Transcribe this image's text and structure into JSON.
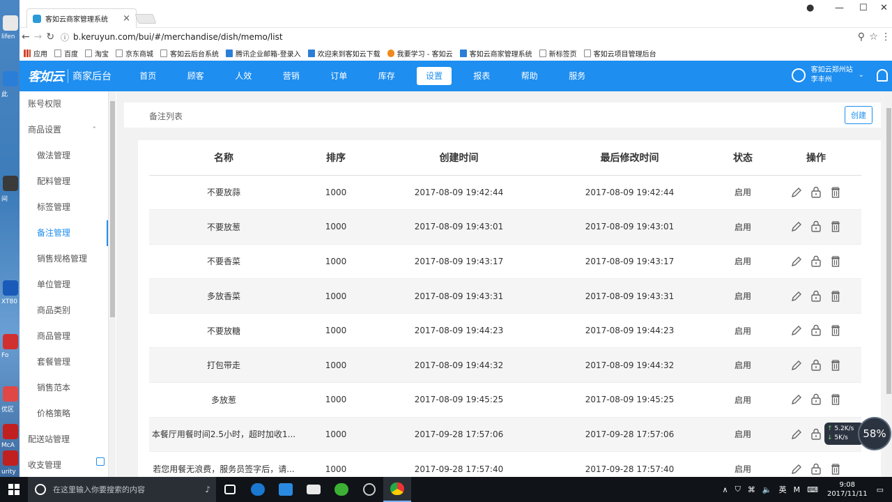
{
  "desktop": {
    "labels": [
      "lifen",
      "此",
      "间",
      "XT80",
      "Fo",
      "优区",
      "McA",
      "urity"
    ]
  },
  "browser": {
    "tab_title": "客如云商家管理系统",
    "url": "b.keruyun.com/bui/#/merchandise/dish/memo/list",
    "bookmarks": [
      "应用",
      "百度",
      "淘宝",
      "京东商城",
      "客如云后台系统",
      "腾讯企业邮箱-登录入",
      "欢迎来到客如云下载",
      "我要学习 - 客如云",
      "客如云商家管理系统",
      "新标签页",
      "客如云项目管理后台"
    ]
  },
  "app": {
    "logo": "客如云",
    "logo_sub": "商家后台",
    "nav": [
      "首页",
      "顾客",
      "人效",
      "营销",
      "订单",
      "库存",
      "设置",
      "报表",
      "帮助",
      "服务"
    ],
    "active_nav": "设置",
    "user_store": "客如云郑州站",
    "user_name": "李丰州"
  },
  "sidebar": {
    "items": [
      {
        "label": "账号权限",
        "sub": false
      },
      {
        "label": "商品设置",
        "sub": false,
        "expanded": true
      },
      {
        "label": "做法管理",
        "sub": true
      },
      {
        "label": "配料管理",
        "sub": true
      },
      {
        "label": "标签管理",
        "sub": true
      },
      {
        "label": "备注管理",
        "sub": true,
        "active": true
      },
      {
        "label": "销售规格管理",
        "sub": true
      },
      {
        "label": "单位管理",
        "sub": true
      },
      {
        "label": "商品类别",
        "sub": true
      },
      {
        "label": "商品管理",
        "sub": true
      },
      {
        "label": "套餐管理",
        "sub": true
      },
      {
        "label": "销售范本",
        "sub": true
      },
      {
        "label": "价格策略",
        "sub": true
      },
      {
        "label": "配送站管理",
        "sub": false
      },
      {
        "label": "收支管理",
        "sub": false
      }
    ]
  },
  "page": {
    "breadcrumb": "备注列表",
    "create_label": "创建"
  },
  "table": {
    "headers": [
      "名称",
      "排序",
      "创建时间",
      "最后修改时间",
      "状态",
      "操作"
    ],
    "rows": [
      {
        "name": "不要放蒜",
        "order": "1000",
        "created": "2017-08-09 19:42:44",
        "modified": "2017-08-09 19:42:44",
        "status": "启用"
      },
      {
        "name": "不要放葱",
        "order": "1000",
        "created": "2017-08-09 19:43:01",
        "modified": "2017-08-09 19:43:01",
        "status": "启用"
      },
      {
        "name": "不要香菜",
        "order": "1000",
        "created": "2017-08-09 19:43:17",
        "modified": "2017-08-09 19:43:17",
        "status": "启用"
      },
      {
        "name": "多放香菜",
        "order": "1000",
        "created": "2017-08-09 19:43:31",
        "modified": "2017-08-09 19:43:31",
        "status": "启用"
      },
      {
        "name": "不要放糖",
        "order": "1000",
        "created": "2017-08-09 19:44:23",
        "modified": "2017-08-09 19:44:23",
        "status": "启用"
      },
      {
        "name": "打包带走",
        "order": "1000",
        "created": "2017-08-09 19:44:32",
        "modified": "2017-08-09 19:44:32",
        "status": "启用"
      },
      {
        "name": "多放葱",
        "order": "1000",
        "created": "2017-08-09 19:45:25",
        "modified": "2017-08-09 19:45:25",
        "status": "启用"
      },
      {
        "name": "本餐厅用餐时间2.5小时，超时加收1...",
        "order": "1000",
        "created": "2017-09-28 17:57:06",
        "modified": "2017-09-28 17:57:06",
        "status": "启用"
      },
      {
        "name": "若您用餐无浪费，服务员签字后，请...",
        "order": "1000",
        "created": "2017-09-28 17:57:40",
        "modified": "2017-09-28 17:57:40",
        "status": "启用"
      }
    ]
  },
  "speed": {
    "up": "5.2K/s",
    "down": "5K/s",
    "percent": "58%"
  },
  "taskbar": {
    "search_placeholder": "在这里输入你要搜索的内容",
    "ime": "英",
    "time": "9:08",
    "date": "2017/11/11"
  },
  "colors": {
    "accent": "#1e8ef0",
    "taskbar": "#101418"
  }
}
